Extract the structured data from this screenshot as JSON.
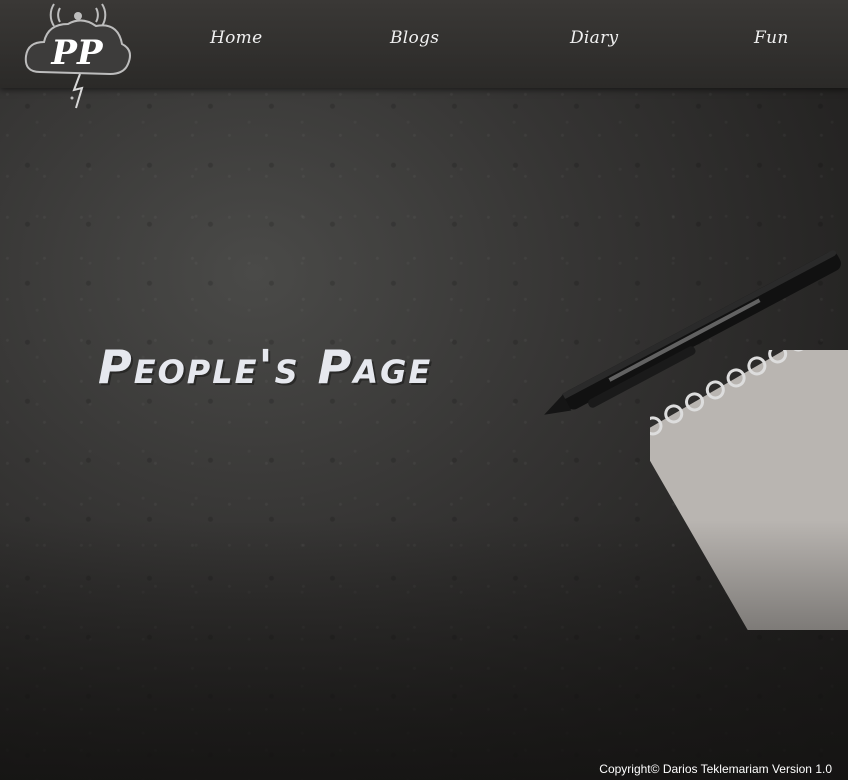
{
  "header": {
    "logo_text": "PP",
    "nav": [
      {
        "label": "Home"
      },
      {
        "label": "Blogs"
      },
      {
        "label": "Diary"
      },
      {
        "label": "Fun"
      }
    ]
  },
  "hero": {
    "title": "People's Page"
  },
  "footer": {
    "copyright": "Copyright© Darios Teklemariam Version 1.0"
  },
  "colors": {
    "background": "#2f2e2c",
    "header": "#323130",
    "title": "#e6e8ee",
    "notebook": "#b9b5b1"
  },
  "icons": {
    "logo": "cloud-logo-icon",
    "pen": "pen-image",
    "notebook": "notebook-image"
  }
}
